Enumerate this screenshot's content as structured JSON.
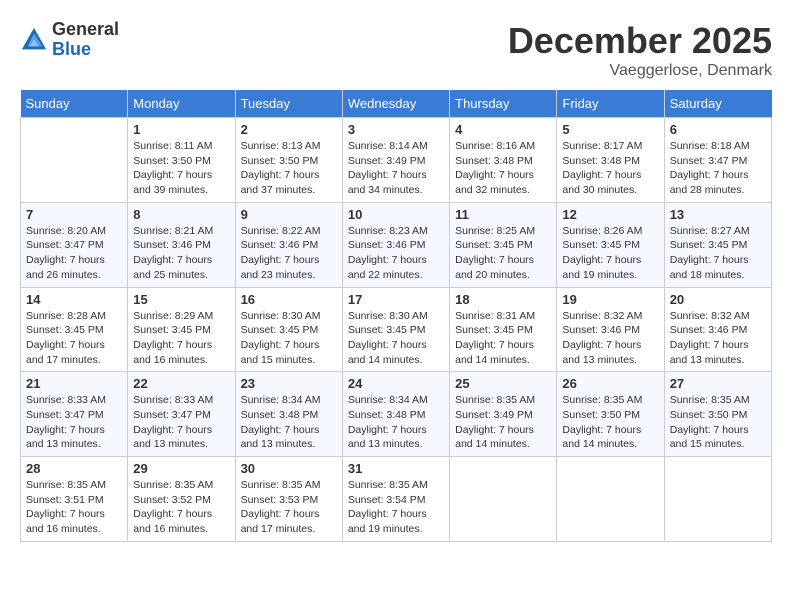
{
  "header": {
    "logo": {
      "general": "General",
      "blue": "Blue"
    },
    "title": "December 2025",
    "location": "Vaeggerlose, Denmark"
  },
  "calendar": {
    "days_of_week": [
      "Sunday",
      "Monday",
      "Tuesday",
      "Wednesday",
      "Thursday",
      "Friday",
      "Saturday"
    ],
    "weeks": [
      [
        {
          "day": "",
          "info": ""
        },
        {
          "day": "1",
          "info": "Sunrise: 8:11 AM\nSunset: 3:50 PM\nDaylight: 7 hours\nand 39 minutes."
        },
        {
          "day": "2",
          "info": "Sunrise: 8:13 AM\nSunset: 3:50 PM\nDaylight: 7 hours\nand 37 minutes."
        },
        {
          "day": "3",
          "info": "Sunrise: 8:14 AM\nSunset: 3:49 PM\nDaylight: 7 hours\nand 34 minutes."
        },
        {
          "day": "4",
          "info": "Sunrise: 8:16 AM\nSunset: 3:48 PM\nDaylight: 7 hours\nand 32 minutes."
        },
        {
          "day": "5",
          "info": "Sunrise: 8:17 AM\nSunset: 3:48 PM\nDaylight: 7 hours\nand 30 minutes."
        },
        {
          "day": "6",
          "info": "Sunrise: 8:18 AM\nSunset: 3:47 PM\nDaylight: 7 hours\nand 28 minutes."
        }
      ],
      [
        {
          "day": "7",
          "info": "Sunrise: 8:20 AM\nSunset: 3:47 PM\nDaylight: 7 hours\nand 26 minutes."
        },
        {
          "day": "8",
          "info": "Sunrise: 8:21 AM\nSunset: 3:46 PM\nDaylight: 7 hours\nand 25 minutes."
        },
        {
          "day": "9",
          "info": "Sunrise: 8:22 AM\nSunset: 3:46 PM\nDaylight: 7 hours\nand 23 minutes."
        },
        {
          "day": "10",
          "info": "Sunrise: 8:23 AM\nSunset: 3:46 PM\nDaylight: 7 hours\nand 22 minutes."
        },
        {
          "day": "11",
          "info": "Sunrise: 8:25 AM\nSunset: 3:45 PM\nDaylight: 7 hours\nand 20 minutes."
        },
        {
          "day": "12",
          "info": "Sunrise: 8:26 AM\nSunset: 3:45 PM\nDaylight: 7 hours\nand 19 minutes."
        },
        {
          "day": "13",
          "info": "Sunrise: 8:27 AM\nSunset: 3:45 PM\nDaylight: 7 hours\nand 18 minutes."
        }
      ],
      [
        {
          "day": "14",
          "info": "Sunrise: 8:28 AM\nSunset: 3:45 PM\nDaylight: 7 hours\nand 17 minutes."
        },
        {
          "day": "15",
          "info": "Sunrise: 8:29 AM\nSunset: 3:45 PM\nDaylight: 7 hours\nand 16 minutes."
        },
        {
          "day": "16",
          "info": "Sunrise: 8:30 AM\nSunset: 3:45 PM\nDaylight: 7 hours\nand 15 minutes."
        },
        {
          "day": "17",
          "info": "Sunrise: 8:30 AM\nSunset: 3:45 PM\nDaylight: 7 hours\nand 14 minutes."
        },
        {
          "day": "18",
          "info": "Sunrise: 8:31 AM\nSunset: 3:45 PM\nDaylight: 7 hours\nand 14 minutes."
        },
        {
          "day": "19",
          "info": "Sunrise: 8:32 AM\nSunset: 3:46 PM\nDaylight: 7 hours\nand 13 minutes."
        },
        {
          "day": "20",
          "info": "Sunrise: 8:32 AM\nSunset: 3:46 PM\nDaylight: 7 hours\nand 13 minutes."
        }
      ],
      [
        {
          "day": "21",
          "info": "Sunrise: 8:33 AM\nSunset: 3:47 PM\nDaylight: 7 hours\nand 13 minutes."
        },
        {
          "day": "22",
          "info": "Sunrise: 8:33 AM\nSunset: 3:47 PM\nDaylight: 7 hours\nand 13 minutes."
        },
        {
          "day": "23",
          "info": "Sunrise: 8:34 AM\nSunset: 3:48 PM\nDaylight: 7 hours\nand 13 minutes."
        },
        {
          "day": "24",
          "info": "Sunrise: 8:34 AM\nSunset: 3:48 PM\nDaylight: 7 hours\nand 13 minutes."
        },
        {
          "day": "25",
          "info": "Sunrise: 8:35 AM\nSunset: 3:49 PM\nDaylight: 7 hours\nand 14 minutes."
        },
        {
          "day": "26",
          "info": "Sunrise: 8:35 AM\nSunset: 3:50 PM\nDaylight: 7 hours\nand 14 minutes."
        },
        {
          "day": "27",
          "info": "Sunrise: 8:35 AM\nSunset: 3:50 PM\nDaylight: 7 hours\nand 15 minutes."
        }
      ],
      [
        {
          "day": "28",
          "info": "Sunrise: 8:35 AM\nSunset: 3:51 PM\nDaylight: 7 hours\nand 16 minutes."
        },
        {
          "day": "29",
          "info": "Sunrise: 8:35 AM\nSunset: 3:52 PM\nDaylight: 7 hours\nand 16 minutes."
        },
        {
          "day": "30",
          "info": "Sunrise: 8:35 AM\nSunset: 3:53 PM\nDaylight: 7 hours\nand 17 minutes."
        },
        {
          "day": "31",
          "info": "Sunrise: 8:35 AM\nSunset: 3:54 PM\nDaylight: 7 hours\nand 19 minutes."
        },
        {
          "day": "",
          "info": ""
        },
        {
          "day": "",
          "info": ""
        },
        {
          "day": "",
          "info": ""
        }
      ]
    ]
  }
}
